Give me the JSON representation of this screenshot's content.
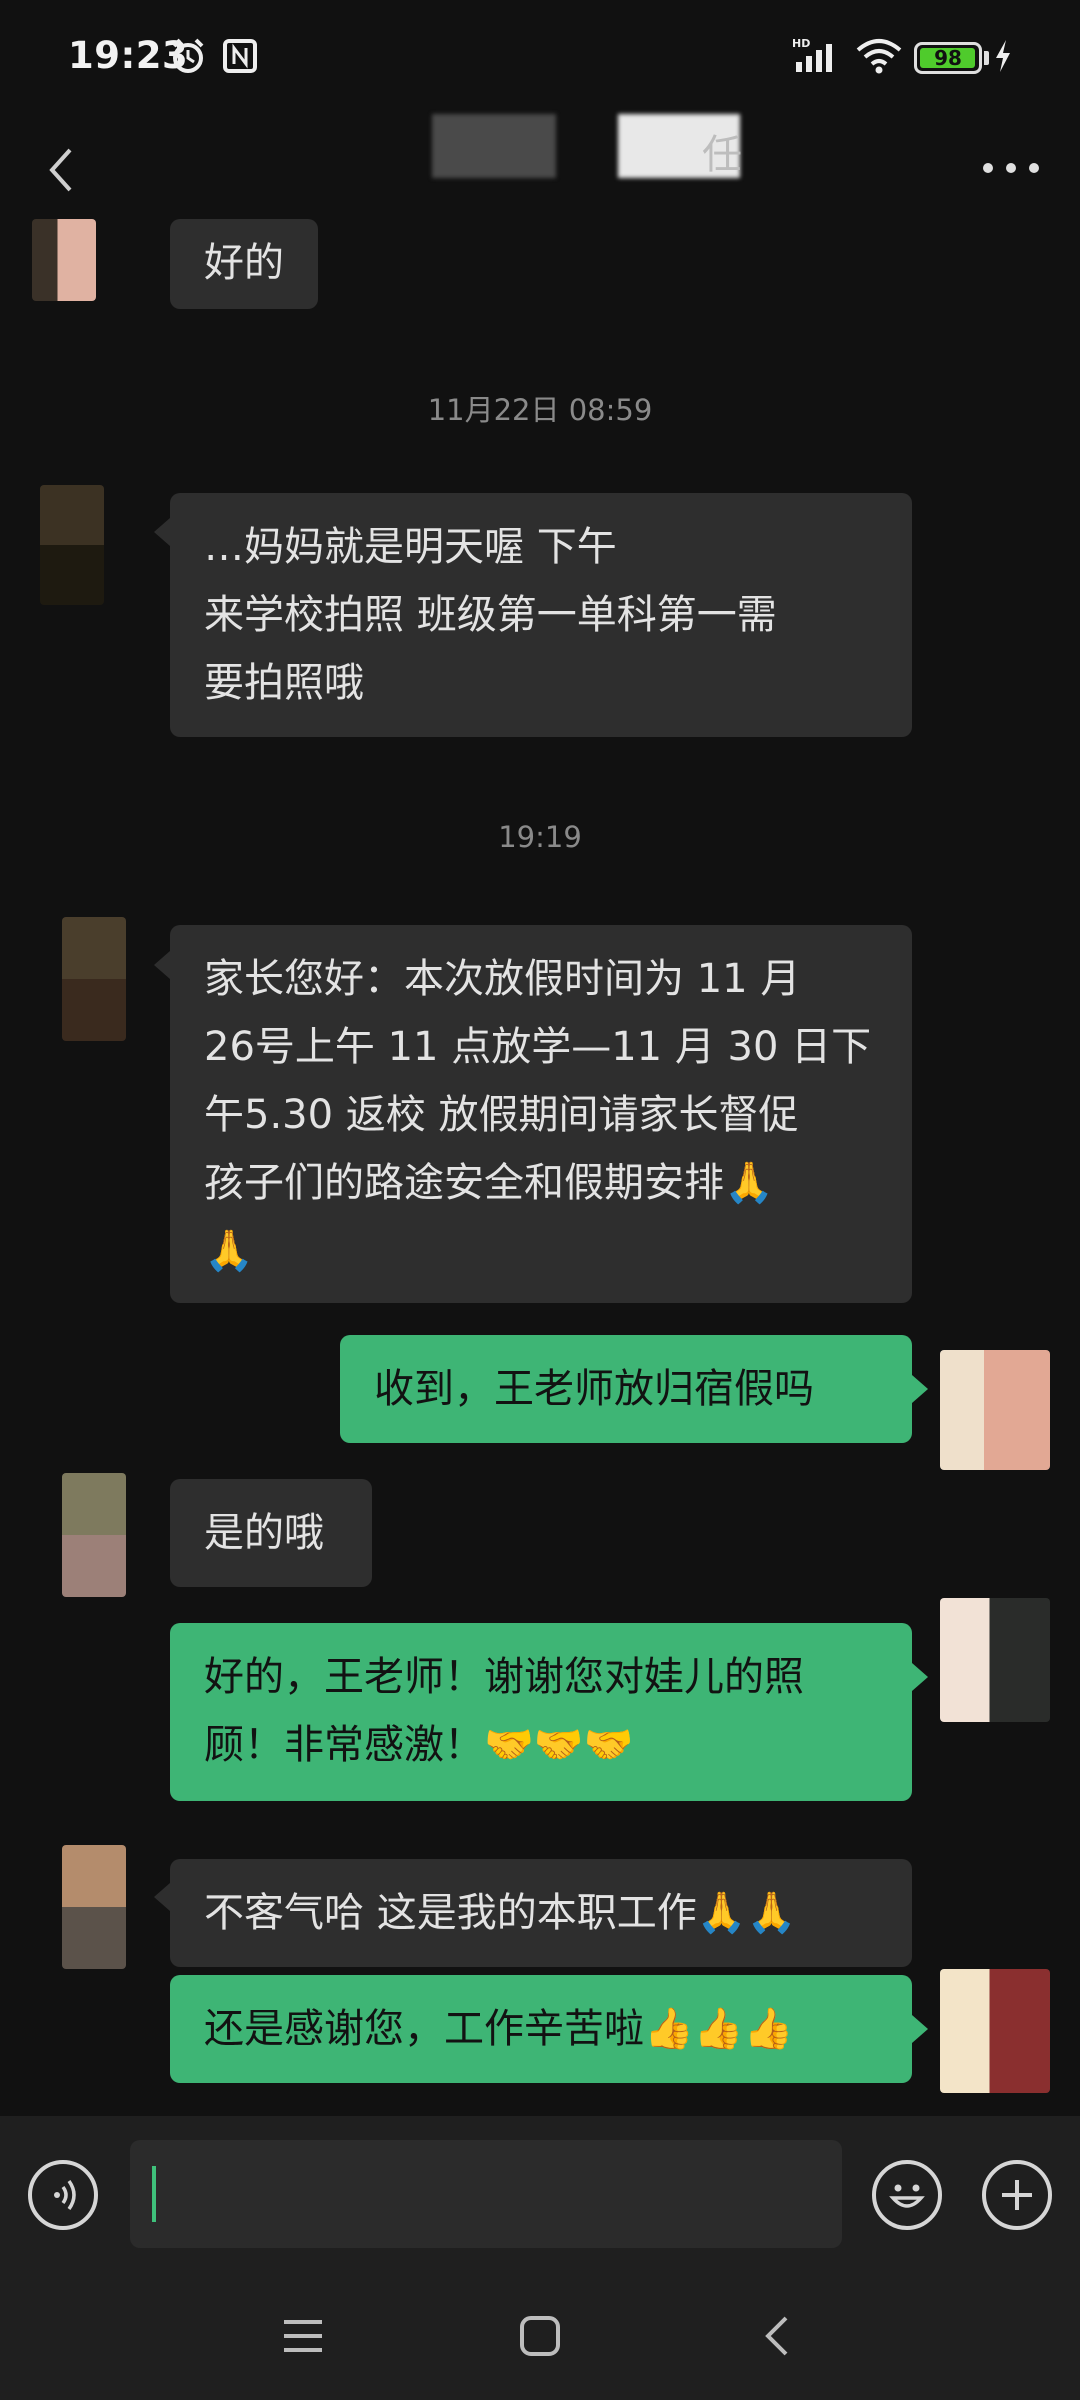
{
  "status_bar": {
    "time": "19:23",
    "battery": "98",
    "battery_level": 0.98,
    "icons": [
      "alarm-icon",
      "nfc-icon",
      "hd-signal-icon",
      "wifi-icon",
      "battery-icon",
      "charging-icon"
    ]
  },
  "header": {
    "title_suffix": "任",
    "back_icon": "chevron-left-icon",
    "more_icon": "more-dots-icon"
  },
  "messages": {
    "m0": "好的",
    "ts1": "11月22日 08:59",
    "m1_l1": "…妈妈就是明天喔    下午",
    "m1_l2": "来学校拍照 班级第一单科第一需",
    "m1_l3": "要拍照哦",
    "ts2": "19:19",
    "m2_l1": "家长您好：本次放假时间为 11 月",
    "m2_l2": "26号上午 11 点放学—11 月 30 日下",
    "m2_l3": "午5.30 返校 放假期间请家长督促",
    "m2_l4": "孩子们的路途安全和假期安排🙏",
    "m2_l5": "🙏",
    "m3": "收到，王老师放归宿假吗",
    "m4": "是的哦",
    "m5_l1": "好的，王老师！谢谢您对娃儿的照",
    "m5_l2": "顾！非常感激！🤝🤝🤝",
    "m6": "不客气哈 这是我的本职工作🙏🙏",
    "m7": "还是感谢您，工作辛苦啦👍👍👍"
  },
  "input_bar": {
    "voice_icon": "voice-icon",
    "emoji_icon": "emoji-icon",
    "plus_icon": "plus-icon",
    "value": ""
  },
  "nav_bar": {
    "icons": [
      "menu-icon",
      "home-icon",
      "back-icon"
    ]
  },
  "colors": {
    "background": "#111111",
    "incoming_bubble": "#2e2e2e",
    "outgoing_bubble": "#3eb575",
    "timestamp": "#8a8a8a"
  }
}
